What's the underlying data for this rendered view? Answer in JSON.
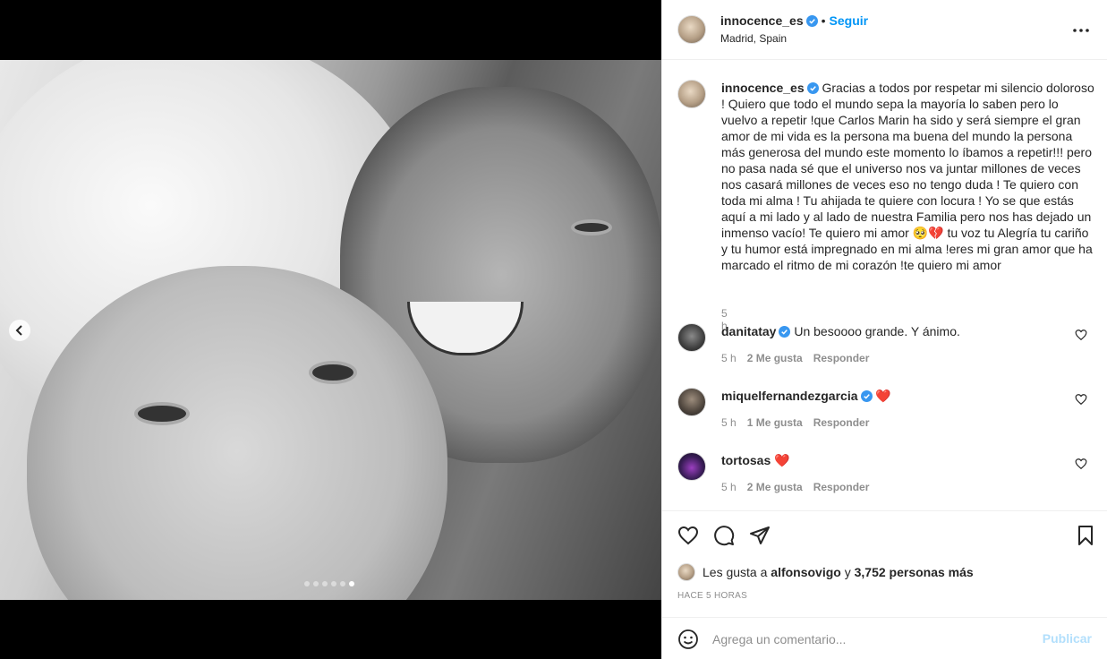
{
  "media": {
    "carousel_total": 6,
    "carousel_active_index": 6
  },
  "post_header": {
    "username": "innocence_es",
    "separator": "•",
    "follow_label": "Seguir",
    "location": "Madrid, Spain"
  },
  "caption": {
    "username": "innocence_es",
    "text": "Gracias a todos por respetar mi silencio doloroso ! Quiero que todo el mundo sepa la mayoría lo saben pero lo vuelvo a repetir !que Carlos Marin ha sido y será siempre el gran amor de mi vida es la persona ma buena del mundo la persona más generosa del mundo este momento lo íbamos a repetir!!! pero no pasa nada sé que el universo nos va juntar millones de veces nos casará millones de veces eso no tengo duda ! Te quiero con toda mi alma ! Tu ahijada te quiere con locura ! Yo se que estás aquí a mi lado y al lado de nuestra Familia pero nos has dejado un inmenso vacío! Te quiero mi amor 🥺💔 tu voz tu Alegría tu cariño y tu humor está impregnado en mi alma !eres mi gran amor que ha marcado el ritmo de mi corazón !te quiero mi amor",
    "time": "5 h"
  },
  "comments": [
    {
      "username": "danitatay",
      "verified": true,
      "text": "Un besoooo grande. Y ánimo.",
      "time": "5 h",
      "likes": "2 Me gusta",
      "reply": "Responder"
    },
    {
      "username": "miquelfernandezgarcia",
      "verified": true,
      "text": "❤️",
      "time": "5 h",
      "likes": "1 Me gusta",
      "reply": "Responder"
    },
    {
      "username": "tortosas",
      "verified": false,
      "text": "❤️",
      "time": "5 h",
      "likes": "2 Me gusta",
      "reply": "Responder"
    }
  ],
  "likes": {
    "prefix": "Les gusta a",
    "user": "alfonsovigo",
    "connector": "y",
    "others": "3,752 personas más"
  },
  "posted_ago": "HACE 5 HORAS",
  "add_comment": {
    "placeholder": "Agrega un comentario...",
    "publish_label": "Publicar"
  },
  "colors": {
    "accent": "#0095f6",
    "publish_disabled": "#b2dffc",
    "verified": "#3897f0",
    "heart_red": "#ed4956",
    "muted": "#8e8e8e"
  },
  "icons": [
    "chevron-left-icon",
    "more-options-icon",
    "verified-icon",
    "heart-icon",
    "comment-icon",
    "share-icon",
    "bookmark-icon",
    "emoji-icon"
  ]
}
